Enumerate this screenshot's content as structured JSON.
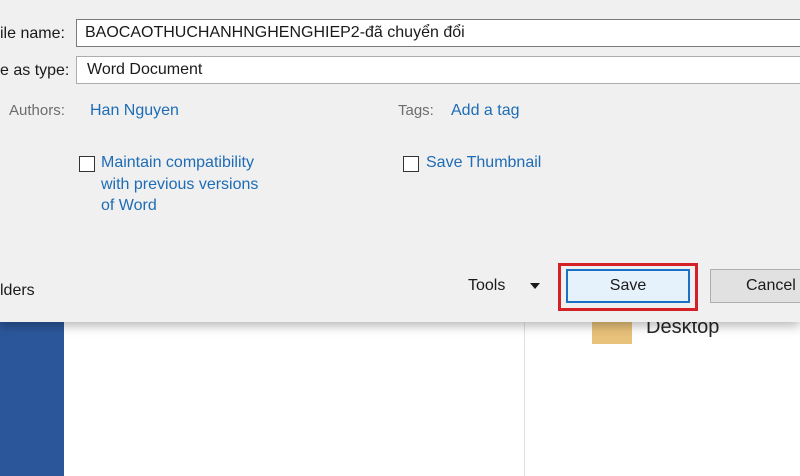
{
  "background": {
    "folder_label": "Desktop",
    "folder_color": "#e8c27a",
    "sidebar_color": "#2b579a"
  },
  "dialog": {
    "file_name_label": "ile name:",
    "file_name_value": "BAOCAOTHUCHANHNGHENGHIEP2-đã chuyển đổi",
    "save_as_type_label": "e as type:",
    "save_as_type_value": "Word Document",
    "authors_label": "Authors:",
    "authors_value": "Han Nguyen",
    "tags_label": "Tags:",
    "tags_value": "Add a tag",
    "maintain_compat_label": "Maintain compatibility with previous versions of Word",
    "save_thumbnail_label": "Save Thumbnail",
    "folders_label": "lders",
    "tools_label": "Tools",
    "save_button": "Save",
    "cancel_button": "Cancel",
    "highlight_color": "#d42027",
    "link_color": "#1e6cb5"
  }
}
